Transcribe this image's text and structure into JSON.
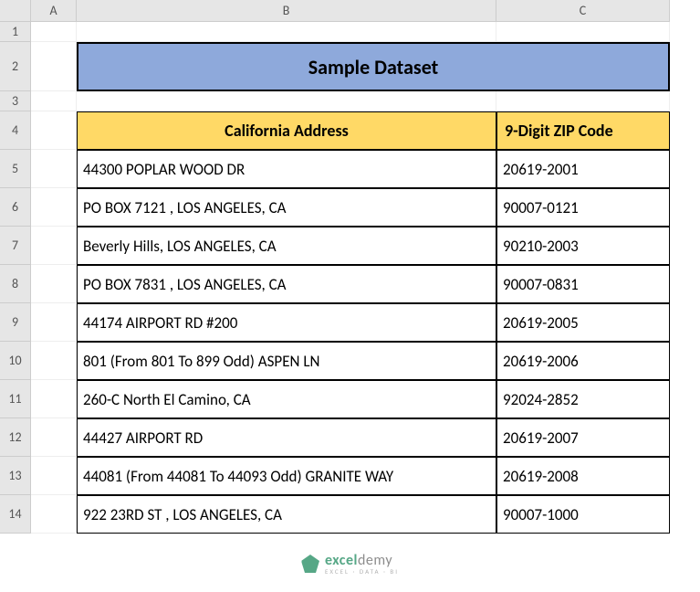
{
  "columns": [
    "A",
    "B",
    "C"
  ],
  "rows": [
    "1",
    "2",
    "3",
    "4",
    "5",
    "6",
    "7",
    "8",
    "9",
    "10",
    "11",
    "12",
    "13",
    "14"
  ],
  "title": "Sample Dataset",
  "headers": {
    "address": "California Address",
    "zip": "9-Digit ZIP Code"
  },
  "data": [
    {
      "address": "44300 POPLAR WOOD DR",
      "zip": "20619-2001"
    },
    {
      "address": "PO BOX 7121 , LOS ANGELES, CA",
      "zip": "90007-0121"
    },
    {
      "address": "Beverly Hills,  LOS ANGELES, CA",
      "zip": "90210-2003"
    },
    {
      "address": "PO BOX 7831 , LOS ANGELES, CA",
      "zip": "90007-0831"
    },
    {
      "address": "44174 AIRPORT RD #200",
      "zip": "20619-2005"
    },
    {
      "address": "801 (From 801 To 899 Odd) ASPEN LN",
      "zip": "20619-2006"
    },
    {
      "address": "260-C North El Camino, CA",
      "zip": "92024-2852"
    },
    {
      "address": "44427 AIRPORT RD",
      "zip": "20619-2007"
    },
    {
      "address": "44081 (From 44081 To 44093 Odd) GRANITE WAY",
      "zip": "20619-2008"
    },
    {
      "address": "922 23RD ST , LOS ANGELES, CA",
      "zip": "90007-1000"
    }
  ],
  "watermark": {
    "brand_a": "excel",
    "brand_b": "demy",
    "sub": "EXCEL · DATA · BI"
  }
}
